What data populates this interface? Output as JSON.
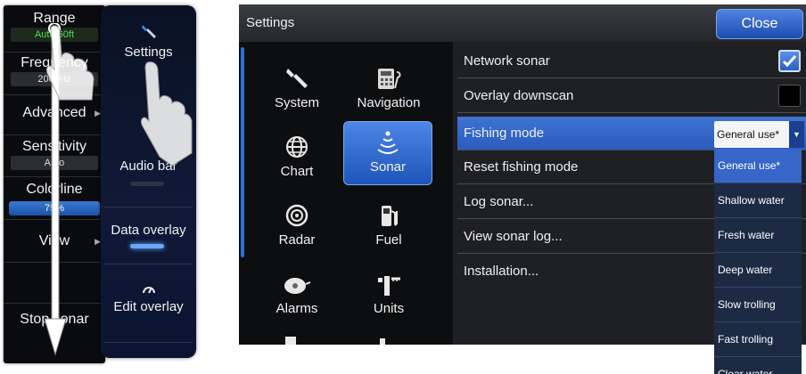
{
  "left_menu": {
    "range": {
      "label": "Range",
      "value": "Auto 60ft"
    },
    "frequency": {
      "label": "Frequency",
      "value": "200kHz"
    },
    "advanced": {
      "label": "Advanced"
    },
    "sensitivity": {
      "label": "Sensitivity",
      "value": "Auto"
    },
    "colorline": {
      "label": "Colorline",
      "value": "75%"
    },
    "view": {
      "label": "View"
    },
    "stop_sonar": {
      "label": "Stop sonar"
    }
  },
  "middle_menu": {
    "settings": {
      "label": "Settings",
      "icon": "wrench-icon"
    },
    "audio_bar": {
      "label": "Audio bar"
    },
    "data_overlay": {
      "label": "Data overlay"
    },
    "edit_overlay": {
      "label": "Edit overlay",
      "icon": "gauge-icon"
    }
  },
  "settings_dialog": {
    "title": "Settings",
    "close_label": "Close",
    "categories": [
      {
        "label": "System",
        "icon": "wrench-icon"
      },
      {
        "label": "Navigation",
        "icon": "calculator-icon"
      },
      {
        "label": "Chart",
        "icon": "globe-icon"
      },
      {
        "label": "Sonar",
        "icon": "sonar-icon",
        "selected": true
      },
      {
        "label": "Radar",
        "icon": "radar-icon"
      },
      {
        "label": "Fuel",
        "icon": "fuel-pump-icon"
      },
      {
        "label": "Alarms",
        "icon": "alarm-icon"
      },
      {
        "label": "Units",
        "icon": "ruler-icon"
      }
    ],
    "options": [
      {
        "label": "Network sonar",
        "checked": true
      },
      {
        "label": "Overlay downscan",
        "checked": false
      },
      {
        "label": "Fishing mode",
        "value": "General use*"
      },
      {
        "label": "Reset fishing mode"
      },
      {
        "label": "Log sonar..."
      },
      {
        "label": "View sonar log..."
      },
      {
        "label": "Installation..."
      }
    ],
    "fishing_mode_options": [
      "General use*",
      "Shallow water",
      "Fresh water",
      "Deep water",
      "Slow trolling",
      "Fast trolling",
      "Clear water"
    ]
  },
  "colors": {
    "accent": "#2f63c6",
    "selected_green": "#50e050"
  }
}
